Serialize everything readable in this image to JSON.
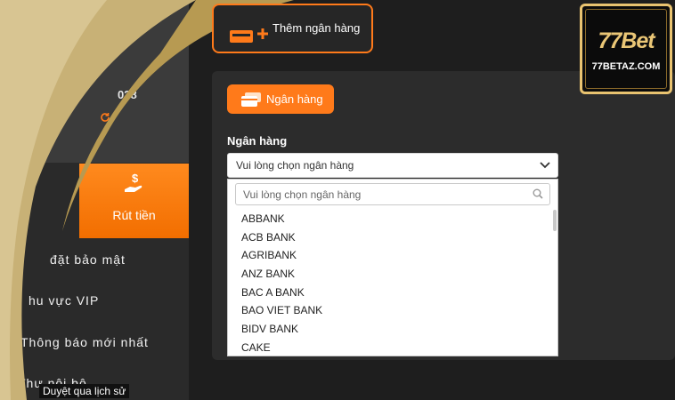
{
  "sidebar": {
    "balance_fragment": "028",
    "withdraw_label": "Rút tiền",
    "menu": [
      "đặt bảo mật",
      "hu vực VIP",
      "Thông báo mới nhất",
      "Thư nội bộ"
    ],
    "history_link": "Duyệt qua lịch sử"
  },
  "add_bank": {
    "label": "Thêm ngân hàng"
  },
  "tab": {
    "label": "Ngân hàng"
  },
  "form": {
    "label": "Ngân hàng",
    "select_value": "Vui lòng chọn ngân hàng"
  },
  "dropdown": {
    "search_placeholder": "Vui lòng chọn ngân hàng",
    "options": [
      "ABBANK",
      "ACB BANK",
      "AGRIBANK",
      "ANZ BANK",
      "BAC A BANK",
      "BAO VIET BANK",
      "BIDV BANK",
      "CAKE"
    ]
  },
  "logo": {
    "mark": "77Bet",
    "domain": "77BETAZ.COM"
  },
  "colors": {
    "accent": "#ff7a1a",
    "gold": "#e9c370",
    "panel": "#2c2c2c"
  },
  "icons": [
    "refresh-icon",
    "money-hand-icon",
    "check-icon",
    "bank-card-icon",
    "card-icon",
    "chevron-down-icon",
    "search-icon"
  ]
}
